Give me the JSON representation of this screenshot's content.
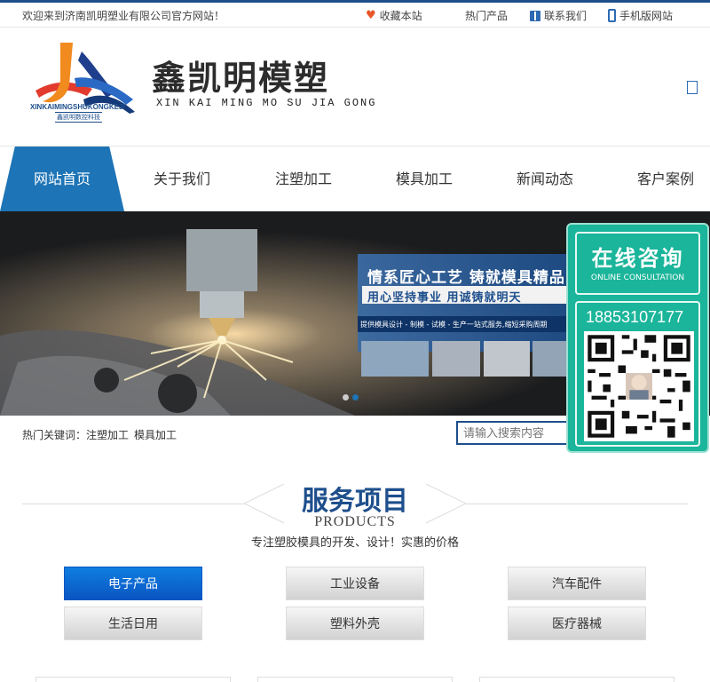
{
  "topbar": {
    "welcome": "欢迎来到济南凯明塑业有限公司官方网站！",
    "favorite": "收藏本站",
    "hot_products": "热门产品",
    "contact": "联系我们",
    "mobile": "手机版网站"
  },
  "header": {
    "logo_text_en": "XINKAIMINGSHUKONGKEJI",
    "logo_text_cn": "鑫凯明数控科技",
    "brand_cn": "鑫凯明模塑",
    "brand_en": "XIN KAI MING MO SU JIA GONG"
  },
  "nav": {
    "items": [
      "网站首页",
      "关于我们",
      "注塑加工",
      "模具加工",
      "新闻动态",
      "客户案例"
    ],
    "active_index": 0
  },
  "banner": {
    "headline": "情系匠心工艺  铸就模具精品",
    "subline": "用心坚持事业  用诚铸就明天",
    "services": "提供模具设计 - 制模 - 试模 - 生产一站式服务,缩短采购周期"
  },
  "search": {
    "label": "热门关键词：",
    "keywords": [
      "注塑加工",
      "模具加工"
    ],
    "placeholder": "请输入搜索内容"
  },
  "float_panel": {
    "title_cn": "在线咨询",
    "title_en": "ONLINE CONSULTATION",
    "phone": "18853107177"
  },
  "section": {
    "title_cn": "服务项目",
    "title_en": "PRODUCTS",
    "description": "专注塑胶模具的开发、设计！实惠的价格"
  },
  "categories": [
    "电子产品",
    "工业设备",
    "汽车配件",
    "生活日用",
    "塑料外壳",
    "医疗器械"
  ],
  "colors": {
    "primary_blue": "#1e4f8c",
    "nav_active": "#1d74b6",
    "float_green": "#1ab59a",
    "category_active": "#0a55c2"
  }
}
